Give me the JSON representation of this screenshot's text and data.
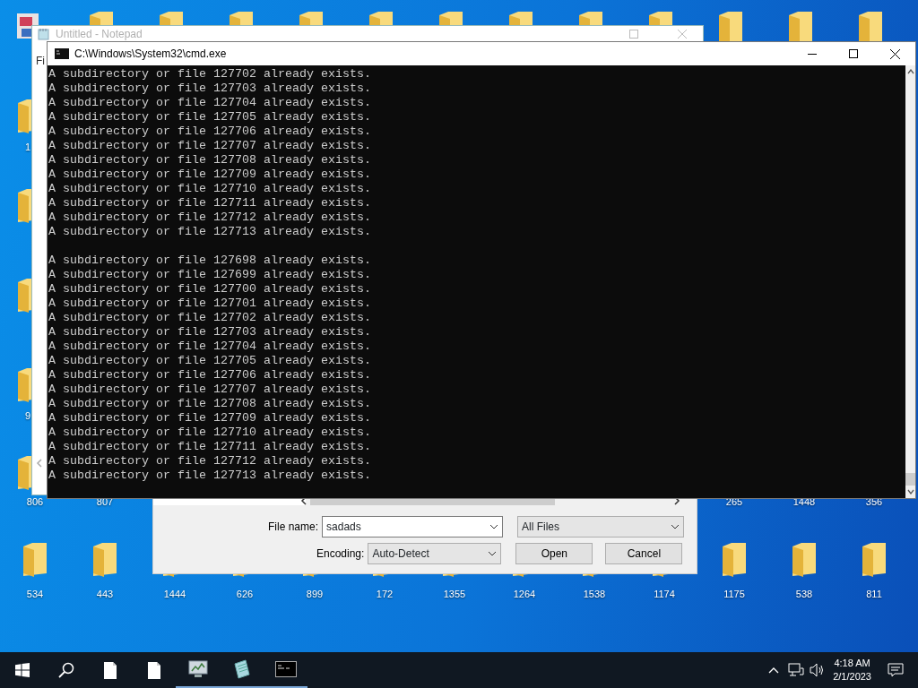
{
  "desktop": {
    "left_column_labels": [
      "1",
      "9"
    ],
    "middle_row_labels": [
      "806",
      "807",
      "265",
      "1448",
      "356"
    ],
    "bottom_row_labels": [
      "534",
      "443",
      "1444",
      "626",
      "899",
      "172",
      "1355",
      "1264",
      "1538",
      "1174",
      "1175",
      "538",
      "811"
    ]
  },
  "notepad": {
    "title": "Untitled - Notepad",
    "menu": "Fi"
  },
  "save_dialog": {
    "file_name_label": "File name:",
    "file_name": "sadads",
    "file_type": "All Files",
    "encoding_label": "Encoding:",
    "encoding": "Auto-Detect",
    "buttons": [
      "Open",
      "Cancel"
    ]
  },
  "console": {
    "title": "C:\\Windows\\System32\\cmd.exe",
    "blocks": [
      [
        "A subdirectory or file 127702 already exists.",
        "A subdirectory or file 127703 already exists.",
        "A subdirectory or file 127704 already exists.",
        "A subdirectory or file 127705 already exists.",
        "A subdirectory or file 127706 already exists.",
        "A subdirectory or file 127707 already exists.",
        "A subdirectory or file 127708 already exists.",
        "A subdirectory or file 127709 already exists.",
        "A subdirectory or file 127710 already exists.",
        "A subdirectory or file 127711 already exists.",
        "A subdirectory or file 127712 already exists.",
        "A subdirectory or file 127713 already exists."
      ],
      [
        "A subdirectory or file 127698 already exists.",
        "A subdirectory or file 127699 already exists.",
        "A subdirectory or file 127700 already exists.",
        "A subdirectory or file 127701 already exists.",
        "A subdirectory or file 127702 already exists.",
        "A subdirectory or file 127703 already exists.",
        "A subdirectory or file 127704 already exists.",
        "A subdirectory or file 127705 already exists.",
        "A subdirectory or file 127706 already exists.",
        "A subdirectory or file 127707 already exists.",
        "A subdirectory or file 127708 already exists.",
        "A subdirectory or file 127709 already exists.",
        "A subdirectory or file 127710 already exists.",
        "A subdirectory or file 127711 already exists.",
        "A subdirectory or file 127712 already exists.",
        "A subdirectory or file 127713 already exists."
      ]
    ]
  },
  "taskbar": {
    "apps": [
      {
        "kind": "document",
        "running": false
      },
      {
        "kind": "document",
        "running": false
      },
      {
        "kind": "monitor",
        "running": true
      },
      {
        "kind": "notepad",
        "running": true
      },
      {
        "kind": "console",
        "running": true
      }
    ],
    "time": "4:18 AM",
    "date": "2/1/2023"
  }
}
